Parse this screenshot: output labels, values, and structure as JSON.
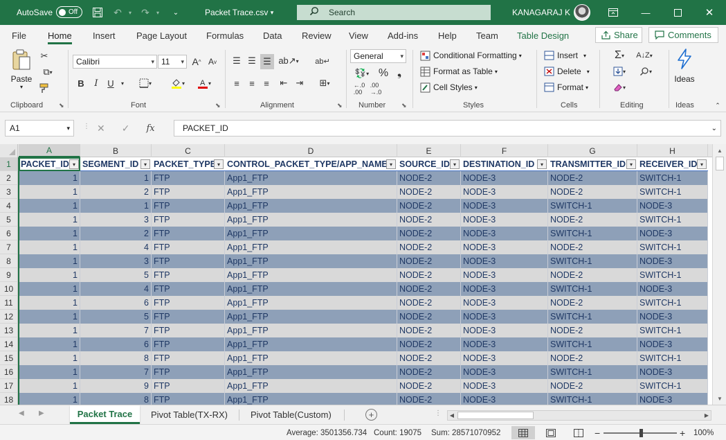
{
  "titlebar": {
    "autosave_label": "AutoSave",
    "autosave_state": "Off",
    "doc_title": "Packet Trace.csv",
    "doc_title_caret": "▾",
    "search_label": "Search",
    "user_name": "KANAGARAJ K",
    "accent": "#217346"
  },
  "ribbon_tabs": {
    "file": "File",
    "home": "Home",
    "insert": "Insert",
    "page_layout": "Page Layout",
    "formulas": "Formulas",
    "data": "Data",
    "review": "Review",
    "view": "View",
    "addins": "Add-ins",
    "help": "Help",
    "team": "Team",
    "table_design": "Table Design",
    "share": "Share",
    "comments": "Comments"
  },
  "ribbon": {
    "clipboard": {
      "paste": "Paste",
      "label": "Clipboard"
    },
    "font": {
      "name": "Calibri",
      "size": "11",
      "label": "Font",
      "bold": "B",
      "italic": "I",
      "underline": "U"
    },
    "alignment": {
      "label": "Alignment"
    },
    "number": {
      "format": "General",
      "label": "Number"
    },
    "styles": {
      "conditional": "Conditional Formatting",
      "format_table": "Format as Table",
      "cell_styles": "Cell Styles",
      "label": "Styles"
    },
    "cells": {
      "insert": "Insert",
      "delete": "Delete",
      "format": "Format",
      "label": "Cells"
    },
    "editing": {
      "label": "Editing"
    },
    "ideas": {
      "button": "Ideas",
      "label": "Ideas"
    }
  },
  "formula_bar": {
    "name_box": "A1",
    "fx": "fx",
    "value": "PACKET_ID"
  },
  "grid": {
    "column_letters": [
      "A",
      "B",
      "C",
      "D",
      "E",
      "F",
      "G",
      "H"
    ],
    "headers": [
      "PACKET_ID",
      "SEGMENT_ID",
      "PACKET_TYPE",
      "CONTROL_PACKET_TYPE/APP_NAME",
      "SOURCE_ID",
      "DESTINATION_ID",
      "TRANSMITTER_ID",
      "RECEIVER_ID"
    ],
    "row_numbers": [
      "1",
      "2",
      "3",
      "4",
      "5",
      "6",
      "7",
      "8",
      "9",
      "10",
      "11",
      "12",
      "13",
      "14",
      "15",
      "16",
      "17",
      "18"
    ],
    "rows": [
      [
        "1",
        "1",
        "FTP",
        "App1_FTP",
        "NODE-2",
        "NODE-3",
        "NODE-2",
        "SWITCH-1"
      ],
      [
        "1",
        "2",
        "FTP",
        "App1_FTP",
        "NODE-2",
        "NODE-3",
        "NODE-2",
        "SWITCH-1"
      ],
      [
        "1",
        "1",
        "FTP",
        "App1_FTP",
        "NODE-2",
        "NODE-3",
        "SWITCH-1",
        "NODE-3"
      ],
      [
        "1",
        "3",
        "FTP",
        "App1_FTP",
        "NODE-2",
        "NODE-3",
        "NODE-2",
        "SWITCH-1"
      ],
      [
        "1",
        "2",
        "FTP",
        "App1_FTP",
        "NODE-2",
        "NODE-3",
        "SWITCH-1",
        "NODE-3"
      ],
      [
        "1",
        "4",
        "FTP",
        "App1_FTP",
        "NODE-2",
        "NODE-3",
        "NODE-2",
        "SWITCH-1"
      ],
      [
        "1",
        "3",
        "FTP",
        "App1_FTP",
        "NODE-2",
        "NODE-3",
        "SWITCH-1",
        "NODE-3"
      ],
      [
        "1",
        "5",
        "FTP",
        "App1_FTP",
        "NODE-2",
        "NODE-3",
        "NODE-2",
        "SWITCH-1"
      ],
      [
        "1",
        "4",
        "FTP",
        "App1_FTP",
        "NODE-2",
        "NODE-3",
        "SWITCH-1",
        "NODE-3"
      ],
      [
        "1",
        "6",
        "FTP",
        "App1_FTP",
        "NODE-2",
        "NODE-3",
        "NODE-2",
        "SWITCH-1"
      ],
      [
        "1",
        "5",
        "FTP",
        "App1_FTP",
        "NODE-2",
        "NODE-3",
        "SWITCH-1",
        "NODE-3"
      ],
      [
        "1",
        "7",
        "FTP",
        "App1_FTP",
        "NODE-2",
        "NODE-3",
        "NODE-2",
        "SWITCH-1"
      ],
      [
        "1",
        "6",
        "FTP",
        "App1_FTP",
        "NODE-2",
        "NODE-3",
        "SWITCH-1",
        "NODE-3"
      ],
      [
        "1",
        "8",
        "FTP",
        "App1_FTP",
        "NODE-2",
        "NODE-3",
        "NODE-2",
        "SWITCH-1"
      ],
      [
        "1",
        "7",
        "FTP",
        "App1_FTP",
        "NODE-2",
        "NODE-3",
        "SWITCH-1",
        "NODE-3"
      ],
      [
        "1",
        "9",
        "FTP",
        "App1_FTP",
        "NODE-2",
        "NODE-3",
        "NODE-2",
        "SWITCH-1"
      ],
      [
        "1",
        "8",
        "FTP",
        "App1_FTP",
        "NODE-2",
        "NODE-3",
        "SWITCH-1",
        "NODE-3"
      ]
    ]
  },
  "sheets": {
    "tab1": "Packet Trace",
    "tab2": "Pivot Table(TX-RX)",
    "tab3": "Pivot Table(Custom)"
  },
  "status": {
    "average": "Average: 3501356.734",
    "count": "Count: 19075",
    "sum": "Sum: 28571070952",
    "zoom_minus": "−",
    "zoom_plus": "+",
    "zoom": "100%"
  }
}
